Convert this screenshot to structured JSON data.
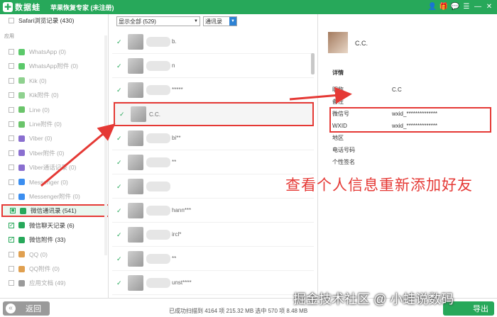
{
  "titlebar": {
    "logo_text": "数据蛙",
    "title": "苹果恢复专家 (未注册)",
    "icons": [
      "user-icon",
      "gift-icon",
      "chat-icon",
      "menu-icon",
      "minimize-icon",
      "close-icon"
    ]
  },
  "sidebar": {
    "top_item": "Safari浏览记录 (430)",
    "section_label": "应用",
    "items": [
      {
        "label": "WhatsApp (0)",
        "icon_color": "#5bc96a",
        "checked": false
      },
      {
        "label": "WhatsApp附件 (0)",
        "icon_color": "#5bc96a",
        "checked": false
      },
      {
        "label": "Kik (0)",
        "icon_color": "#8fd18f",
        "checked": false
      },
      {
        "label": "Kik附件 (0)",
        "icon_color": "#8fd18f",
        "checked": false
      },
      {
        "label": "Line (0)",
        "icon_color": "#6ac46a",
        "checked": false
      },
      {
        "label": "Line附件 (0)",
        "icon_color": "#6ac46a",
        "checked": false
      },
      {
        "label": "Viber (0)",
        "icon_color": "#8a6fd0",
        "checked": false
      },
      {
        "label": "Viber附件 (0)",
        "icon_color": "#8a6fd0",
        "checked": false
      },
      {
        "label": "Viber通话记录 (0)",
        "icon_color": "#8a6fd0",
        "checked": false
      },
      {
        "label": "Messenger (0)",
        "icon_color": "#3b8ef0",
        "checked": false
      },
      {
        "label": "Messenger附件 (0)",
        "icon_color": "#3b8ef0",
        "checked": false
      },
      {
        "label": "微信通讯录 (541)",
        "icon_color": "#27a85a",
        "checked": true,
        "selected": true
      },
      {
        "label": "微信聊天记录 (6)",
        "icon_color": "#27a85a",
        "checked": true
      },
      {
        "label": "微信附件 (33)",
        "icon_color": "#27a85a",
        "checked": true
      },
      {
        "label": "QQ (0)",
        "icon_color": "#e0a050",
        "checked": false
      },
      {
        "label": "QQ附件 (0)",
        "icon_color": "#e0a050",
        "checked": false
      },
      {
        "label": "应用文档 (49)",
        "icon_color": "#9a9a9a",
        "checked": false
      }
    ]
  },
  "list": {
    "filter_value": "显示全部 (529)",
    "view_value": "通讯录",
    "contacts": [
      {
        "name": "b."
      },
      {
        "name": "n"
      },
      {
        "name": "*****"
      },
      {
        "name": "C.C.",
        "selected": true
      },
      {
        "name": "bi**"
      },
      {
        "name": "**"
      },
      {
        "name": ""
      },
      {
        "name": "hann***"
      },
      {
        "name": "ircl*"
      },
      {
        "name": "**"
      },
      {
        "name": "unst****"
      }
    ]
  },
  "detail": {
    "name": "C.C.",
    "section_title": "详情",
    "rows": [
      {
        "key": "昵称",
        "value": "C.C"
      },
      {
        "key": "备注",
        "value": ""
      },
      {
        "key": "微信号",
        "value": "wxid_**************"
      },
      {
        "key": "WXID",
        "value": "wxid_**************"
      },
      {
        "key": "地区",
        "value": ""
      },
      {
        "key": "电话号码",
        "value": ""
      },
      {
        "key": "个性签名",
        "value": ""
      }
    ]
  },
  "annotation": {
    "text": "查看个人信息重新添加好友",
    "color": "#e53935"
  },
  "watermark": "掘金技术社区 @ 小蛙说数码",
  "footer": {
    "back_label": "返回",
    "status": "已成功扫描到 4164 项 215.32 MB  选中 570 项 8.48 MB",
    "export_label": "导出"
  }
}
